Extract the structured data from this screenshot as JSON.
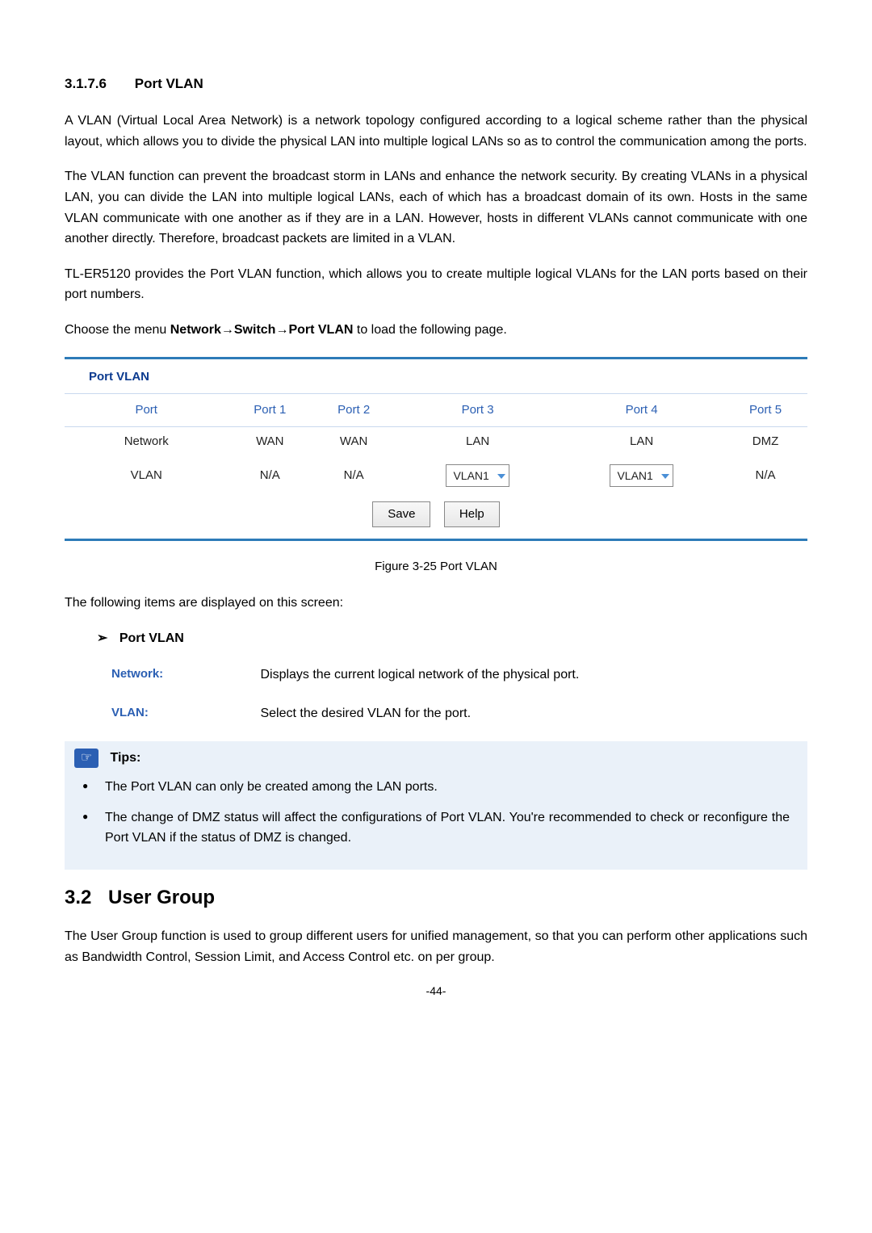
{
  "section_heading": {
    "number": "3.1.7.6",
    "title": "Port VLAN"
  },
  "para1": "A VLAN (Virtual Local Area Network) is a network topology configured according to a logical scheme rather than the physical layout, which allows you to divide the physical LAN into multiple logical LANs so as to control the communication among the ports.",
  "para2": "The VLAN function can prevent the broadcast storm in LANs and enhance the network security. By creating VLANs in a physical LAN, you can divide the LAN into multiple logical LANs, each of which has a broadcast domain of its own. Hosts in the same VLAN communicate with one another as if they are in a LAN. However, hosts in different VLANs cannot communicate with one another directly. Therefore, broadcast packets are limited in a VLAN.",
  "para3": "TL-ER5120 provides the Port VLAN function, which allows you to create multiple logical VLANs for the LAN ports based on their port numbers.",
  "menu_text": {
    "prefix": "Choose the menu ",
    "bold": "Network→Switch→Port VLAN",
    "suffix": " to load the following page."
  },
  "table": {
    "title": "Port VLAN",
    "headers": [
      "Port",
      "Port 1",
      "Port 2",
      "Port 3",
      "Port 4",
      "Port 5"
    ],
    "rows": [
      {
        "label": "Network",
        "values": [
          "WAN",
          "WAN",
          "LAN",
          "LAN",
          "DMZ"
        ]
      },
      {
        "label": "VLAN",
        "values": [
          "N/A",
          "N/A",
          "VLAN1",
          "VLAN1",
          "N/A"
        ],
        "dropdowns": [
          false,
          false,
          true,
          true,
          false
        ]
      }
    ],
    "buttons": {
      "save": "Save",
      "help": "Help"
    }
  },
  "figure_caption": "Figure 3-25 Port VLAN",
  "displayed_text": "The following items are displayed on this screen:",
  "sub_heading": "Port VLAN",
  "descriptions": [
    {
      "label": "Network:",
      "text": "Displays the current logical network of the physical port."
    },
    {
      "label": "VLAN:",
      "text": "Select the desired VLAN for the port."
    }
  ],
  "tips": {
    "label": "Tips:",
    "items": [
      "The Port VLAN can only be created among the LAN ports.",
      "The change of DMZ status will affect the configurations of Port VLAN. You're recommended to check or reconfigure the Port VLAN if the status of DMZ is changed."
    ]
  },
  "user_group": {
    "number": "3.2",
    "title": "User Group",
    "para": "The User Group function is used to group different users for unified management, so that you can perform other applications such as Bandwidth Control, Session Limit, and Access Control etc. on per group."
  },
  "page_number": "-44-"
}
